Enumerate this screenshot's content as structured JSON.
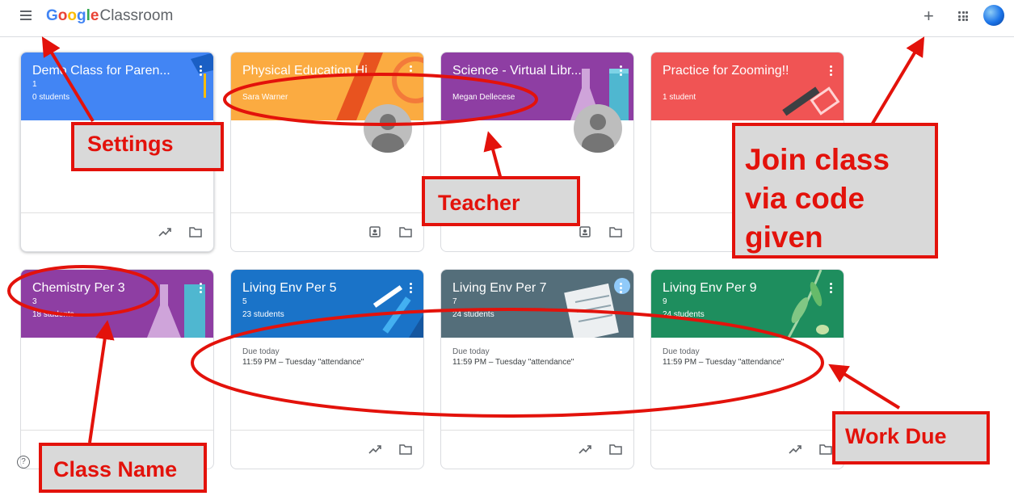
{
  "app": {
    "brand_google": [
      "G",
      "o",
      "o",
      "g",
      "l",
      "e"
    ],
    "brand_product": "Classroom",
    "brand_colors": [
      "#4285f4",
      "#ea4335",
      "#fbbc05",
      "#4285f4",
      "#34a853",
      "#ea4335"
    ]
  },
  "header_icons": [
    "menu-icon",
    "plus-icon",
    "apps-grid-icon",
    "account-avatar"
  ],
  "classes": [
    {
      "title": "Demo Class for Paren...",
      "section": "1",
      "meta": "0 students",
      "color": "#4285f4",
      "footer_icons": [
        "trend-icon",
        "folder-icon"
      ]
    },
    {
      "title": "Physical Education Hi...",
      "section": "",
      "meta": "Sara Warner",
      "color": "#fbab41",
      "teacher_photo": true,
      "footer_icons": [
        "portfolio-icon",
        "folder-icon"
      ]
    },
    {
      "title": "Science - Virtual Libr...",
      "section": "",
      "meta": "Megan Dellecese",
      "color": "#8e3ea3",
      "teacher_photo": true,
      "footer_icons": [
        "portfolio-icon",
        "folder-icon"
      ]
    },
    {
      "title": "Practice for Zooming!!",
      "section": "",
      "meta": "1 student",
      "color": "#f05454",
      "footer_icons": []
    },
    {
      "title": "Chemistry Per 3",
      "section": "3",
      "meta": "18 students",
      "color": "#8e3ea3",
      "footer_icons": []
    },
    {
      "title": "Living Env Per 5",
      "section": "5",
      "meta": "23 students",
      "color": "#1a73c8",
      "due_label": "Due today",
      "due_item": "11:59 PM – Tuesday \"attendance\"",
      "footer_icons": [
        "trend-icon",
        "folder-icon"
      ]
    },
    {
      "title": "Living Env Per 7",
      "section": "7",
      "meta": "24 students",
      "color": "#546e7a",
      "due_label": "Due today",
      "due_item": "11:59 PM – Tuesday \"attendance\"",
      "footer_icons": [
        "trend-icon",
        "folder-icon"
      ]
    },
    {
      "title": "Living Env Per 9",
      "section": "9",
      "meta": "24 students",
      "color": "#1e8e5e",
      "due_label": "Due today",
      "due_item": "11:59 PM – Tuesday \"attendance\"",
      "footer_icons": [
        "trend-icon",
        "folder-icon"
      ]
    }
  ],
  "annotations": {
    "settings": "Settings",
    "teacher": "Teacher",
    "join_class": [
      "Join class",
      "via code",
      "given"
    ],
    "class_name": "Class Name",
    "work_due": "Work Due",
    "color": "#e3120b",
    "box_fill": "#d9d9d9"
  }
}
